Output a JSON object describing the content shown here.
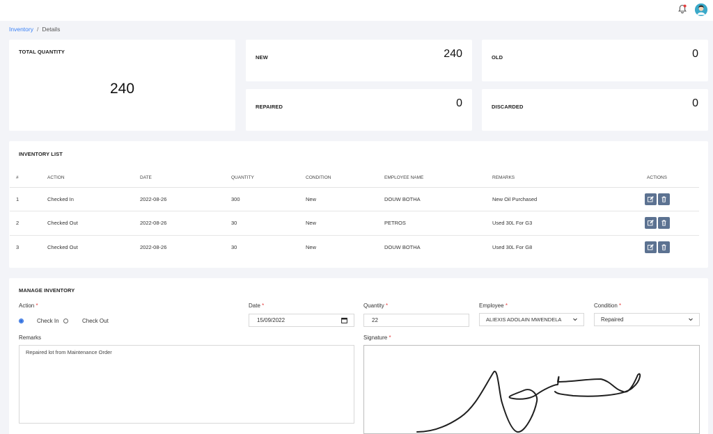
{
  "breadcrumb": {
    "link": "Inventory",
    "separator": "/",
    "current": "Details"
  },
  "stats": {
    "total": {
      "label": "TOTAL QUANTITY",
      "value": "240"
    },
    "new": {
      "label": "NEW",
      "value": "240"
    },
    "old": {
      "label": "OLD",
      "value": "0"
    },
    "repaired": {
      "label": "REPAIRED",
      "value": "0"
    },
    "discarded": {
      "label": "DISCARDED",
      "value": "0"
    }
  },
  "inventory_list": {
    "title": "INVENTORY LIST",
    "columns": [
      "#",
      "ACTION",
      "DATE",
      "QUANTITY",
      "CONDITION",
      "EMPLOYEE NAME",
      "REMARKS",
      "ACTIONS"
    ],
    "rows": [
      {
        "num": "1",
        "action": "Checked In",
        "date": "2022-08-26",
        "quantity": "300",
        "condition": "New",
        "employee": "DOUW BOTHA",
        "remarks": "New Oil Purchased"
      },
      {
        "num": "2",
        "action": "Checked Out",
        "date": "2022-08-26",
        "quantity": "30",
        "condition": "New",
        "employee": "PETROS",
        "remarks": "Used 30L For G3"
      },
      {
        "num": "3",
        "action": "Checked Out",
        "date": "2022-08-26",
        "quantity": "30",
        "condition": "New",
        "employee": "DOUW BOTHA",
        "remarks": "Used 30L For G8"
      }
    ],
    "row_action_icons": [
      "edit-icon",
      "trash-icon"
    ]
  },
  "manage": {
    "title": "MANAGE INVENTORY",
    "action_label": "Action",
    "required_mark": "*",
    "check_in_label": "Check In",
    "check_out_label": "Check Out",
    "selected_action": "Check In",
    "date_label": "Date",
    "date_value": "15/09/2022",
    "quantity_label": "Quantity",
    "quantity_value": "22",
    "employee_label": "Employee",
    "employee_value": "ALIEXIS ADOLAIN MWENDELA",
    "condition_label": "Condition",
    "condition_value": "Repaired",
    "remarks_label": "Remarks",
    "remarks_value": "Repaired lot from Maintenance Order",
    "signature_label": "Signature"
  },
  "colors": {
    "accent": "#3b82f6",
    "action_button": "#5c7291",
    "required": "#e53e3e",
    "page_bg": "#f3f4f8"
  }
}
